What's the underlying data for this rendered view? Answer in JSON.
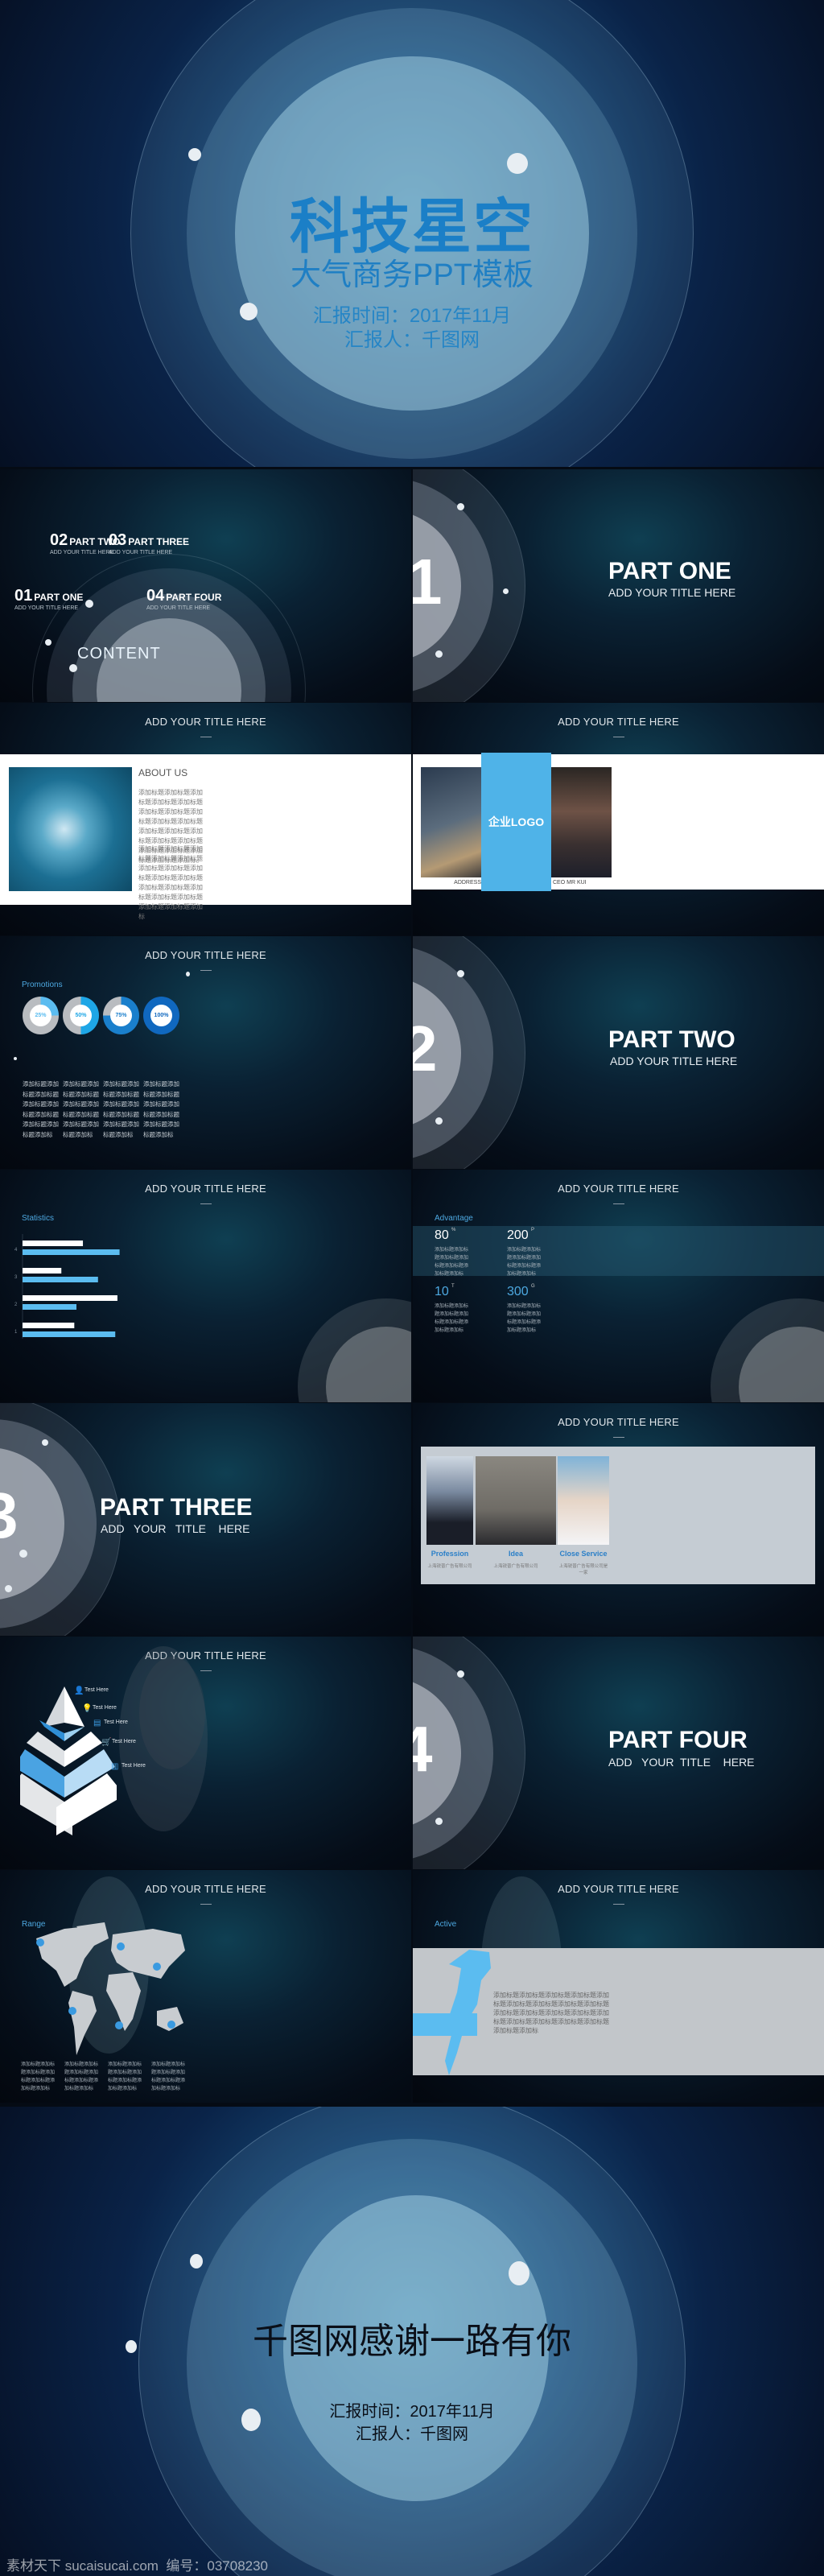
{
  "cover": {
    "title": "科技星空",
    "subtitle": "大气商务PPT模板",
    "date": "汇报时间：2017年11月",
    "reporter": "汇报人：千图网"
  },
  "contents": {
    "label": "CONTENT",
    "items": [
      {
        "num": "01",
        "title": "PART ONE",
        "sub": "ADD YOUR TITLE HERE"
      },
      {
        "num": "02",
        "title": "PART TWO",
        "sub": "ADD YOUR TITLE HERE"
      },
      {
        "num": "03",
        "title": "PART THREE",
        "sub": "ADD YOUR TITLE HERE"
      },
      {
        "num": "04",
        "title": "PART FOUR",
        "sub": "ADD YOUR TITLE HERE"
      }
    ]
  },
  "parts": [
    {
      "num": "1",
      "title": "PART ONE",
      "sub": "ADD YOUR TITLE  HERE"
    },
    {
      "num": "2",
      "title": "PART TWO",
      "sub": "ADD YOUR TITLE  HERE"
    },
    {
      "num": "3",
      "title": "PART THREE",
      "sub": "ADD   YOUR   TITLE    HERE"
    },
    {
      "num": "4",
      "title": "PART FOUR",
      "sub": "ADD   YOUR  TITLE    HERE"
    }
  ],
  "slide_title": "ADD YOUR TITLE  HERE",
  "about": {
    "heading": "ABOUT US",
    "p1": "添加标题添加标题添加标题添加标题添加标题添加标题添加标题添加标题添加标题添加标题添加标题添加标题添加标题添加标题添加标题添加标题添加标题添加标题添加标题添加标。",
    "p2": "添加标题添加标题添加标题添加标题添加标题添加标题添加标题添加标题添加标题添加标题添加标题添加标题添加标题添加标题添加标题添加标题添加标题添加标"
  },
  "logo_slide": {
    "logo": "企业LOGO",
    "address": "ADDRESS",
    "ceo": "CEO MR KUI",
    "logo_color": "#4fb3e8"
  },
  "promotions": {
    "heading": "Promotions",
    "items": [
      {
        "label": "25%",
        "value": 25,
        "color": "#5bbcf0"
      },
      {
        "label": "50%",
        "value": 50,
        "color": "#1ea6e6"
      },
      {
        "label": "75%",
        "value": 75,
        "color": "#1a7fcc"
      },
      {
        "label": "100%",
        "value": 100,
        "color": "#1068bf"
      }
    ],
    "text": "添加标题添加标题添加标题添加标题添加标题添加标题添加标题添加标题添加标"
  },
  "chart_data": {
    "type": "bar",
    "orientation": "horizontal",
    "title": "Statistics",
    "categories": [
      "1",
      "2",
      "3",
      "4"
    ],
    "series": [
      {
        "values": [
          2.4,
          4.4,
          1.8,
          2.8
        ],
        "color": "#ffffff"
      },
      {
        "values": [
          4.3,
          2.5,
          3.5,
          4.5
        ],
        "color": "#5bbcf0"
      }
    ],
    "xlim": [
      0,
      5
    ],
    "xticks": [
      "0",
      "1",
      "2",
      "3",
      "4",
      "5"
    ],
    "grid": false
  },
  "advantage": {
    "heading": "Advantage",
    "items": [
      {
        "value": "80",
        "unit": "%",
        "color": "#ffffff"
      },
      {
        "value": "200",
        "unit": "P",
        "color": "#ffffff"
      },
      {
        "value": "10",
        "unit": "T",
        "color": "#4da8e0"
      },
      {
        "value": "300",
        "unit": "G",
        "color": "#4da8e0"
      }
    ],
    "text": "添加标题添加标题添加标题添加标题添加标题添加标题添加标"
  },
  "services": {
    "items": [
      {
        "title": "Profession",
        "sub": "上海锐普广告有限公司"
      },
      {
        "title": "Idea",
        "sub": "上海锐普广告有限公司"
      },
      {
        "title": "Close Service",
        "sub": "上海锐普广告有限公司是一家"
      }
    ],
    "accent": "#2a7fc8"
  },
  "pyramid": {
    "items": [
      {
        "label": "Test Here",
        "icon": "user-icon"
      },
      {
        "label": "Test Here",
        "icon": "lightbulb-icon"
      },
      {
        "label": "Test Here",
        "icon": "calendar-icon"
      },
      {
        "label": "Test Here",
        "icon": "cart-icon"
      },
      {
        "label": "Test Here",
        "icon": "bar-chart-icon"
      }
    ]
  },
  "range": {
    "heading": "Range",
    "text": "添加标题添加标题添加标题添加标题添加标题添加标题添加标"
  },
  "active": {
    "heading": "Active",
    "text": "添加标题添加标题添加标题添加标题添加标题添加标题添加标题添加标题添加标题添加标题添加标题添加标题添加标题添加标题添加标题添加标题添加标题添加标题添加标题添加标"
  },
  "ending": {
    "title": "千图网感谢一路有你",
    "date": "汇报时间：2017年11月",
    "reporter": "汇报人：千图网"
  },
  "watermark": "素材天下 sucaisucai.com  编号：03708230"
}
